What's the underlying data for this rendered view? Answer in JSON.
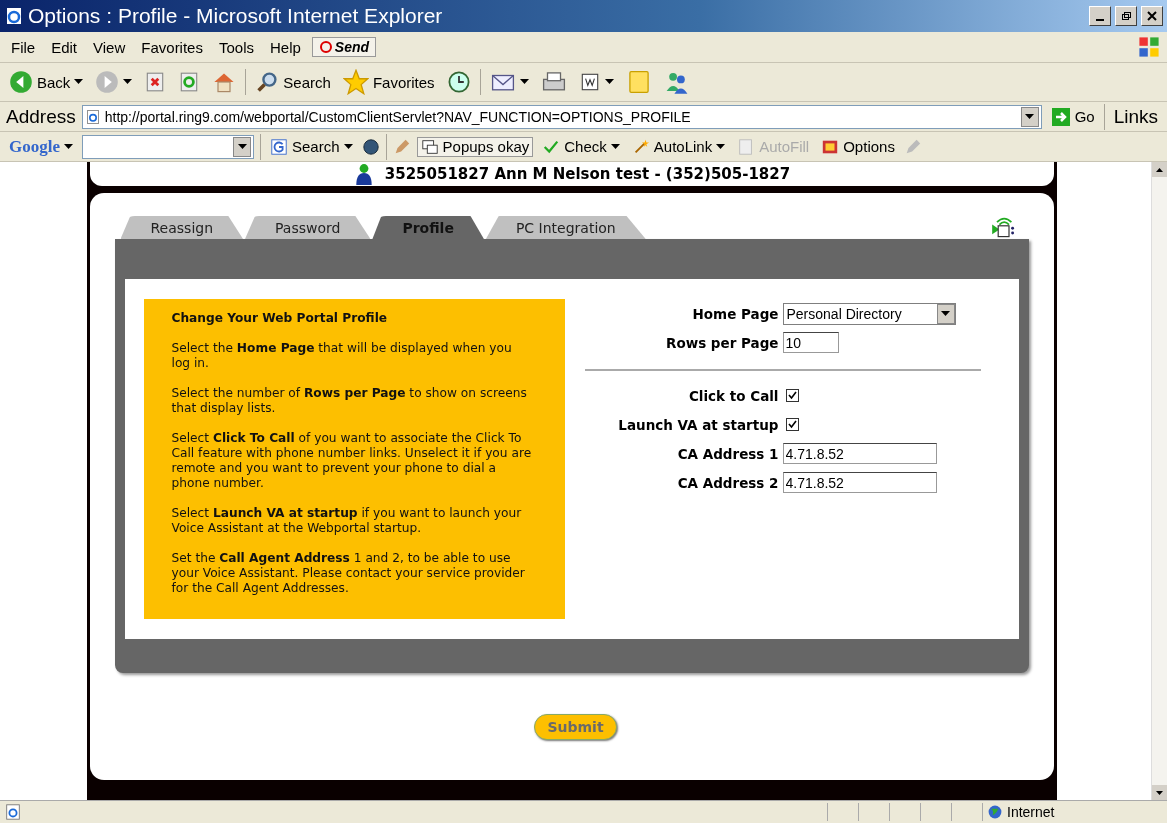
{
  "window": {
    "title": "Options : Profile - Microsoft Internet Explorer"
  },
  "menu": [
    "File",
    "Edit",
    "View",
    "Favorites",
    "Tools",
    "Help"
  ],
  "send_button": "Send",
  "toolbar": [
    {
      "kind": "back",
      "label": "Back"
    },
    {
      "kind": "forward"
    },
    {
      "kind": "stop"
    },
    {
      "kind": "refresh"
    },
    {
      "kind": "home"
    },
    {
      "kind": "search",
      "label": "Search"
    },
    {
      "kind": "favorites",
      "label": "Favorites"
    },
    {
      "kind": "history"
    },
    {
      "kind": "mail"
    },
    {
      "kind": "print"
    },
    {
      "kind": "edit"
    },
    {
      "kind": "note"
    },
    {
      "kind": "messenger"
    }
  ],
  "address_bar": {
    "label": "Address",
    "url": "http://portal.ring9.com/webportal/CustomClientServlet?NAV_FUNCTION=OPTIONS_PROFILE",
    "go": "Go",
    "links": "Links"
  },
  "google_bar": {
    "logo": "Google",
    "items": [
      {
        "kind": "search",
        "label": "Search",
        "disabled": false
      },
      {
        "kind": "popups",
        "label": "Popups okay",
        "disabled": false
      },
      {
        "kind": "check",
        "label": "Check",
        "disabled": false
      },
      {
        "kind": "autolink",
        "label": "AutoLink",
        "disabled": false
      },
      {
        "kind": "autofill",
        "label": "AutoFill",
        "disabled": true
      },
      {
        "kind": "options",
        "label": "Options",
        "disabled": false
      }
    ]
  },
  "user": "3525051827 Ann M Nelson test - (352)505-1827",
  "tabs": [
    {
      "label": "Reassign",
      "selected": false
    },
    {
      "label": "Password",
      "selected": false
    },
    {
      "label": "Profile",
      "selected": true
    },
    {
      "label": "PC Integration",
      "selected": false
    }
  ],
  "help": {
    "title": "Change Your Web Portal Profile",
    "paragraphs": [
      "Select the **Home Page** that will be displayed when you log in.",
      "Select the number of **Rows per Page** to show on screens that display lists.",
      "Select **Click To Call** of you want to associate the Click To Call feature with phone number links. Unselect it if you are remote and you want to prevent your phone to dial a phone number.",
      "Select **Launch VA at startup** if you want to launch your Voice Assistant at the Webportal startup.",
      "Set the **Call Agent Address** 1 and 2, to be able to use your Voice Assistant. Please contact your service provider for the Call Agent Addresses."
    ]
  },
  "form": {
    "top": [
      {
        "kind": "select",
        "label": "Home Page",
        "value": "Personal Directory"
      },
      {
        "kind": "text",
        "label": "Rows per Page",
        "value": "10"
      }
    ],
    "bottom": [
      {
        "kind": "checkbox",
        "label": "Click to Call",
        "checked": true
      },
      {
        "kind": "checkbox",
        "label": "Launch VA at startup",
        "checked": true
      },
      {
        "kind": "text",
        "label": "CA Address 1",
        "value": "4.71.8.52"
      },
      {
        "kind": "text",
        "label": "CA Address 2",
        "value": "4.71.8.52"
      }
    ]
  },
  "submit": "Submit",
  "status_bar": {
    "zone": "Internet"
  }
}
